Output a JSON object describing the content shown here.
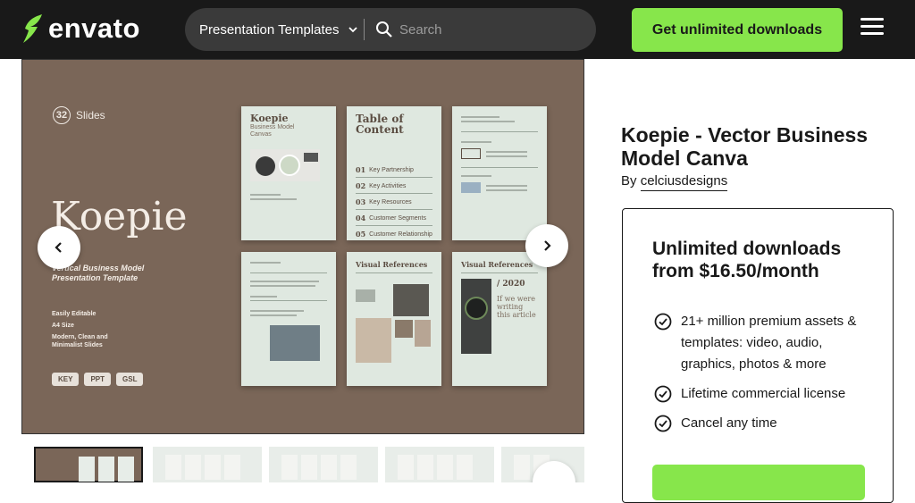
{
  "header": {
    "logo_text": "envato",
    "category": "Presentation Templates",
    "search_placeholder": "Search",
    "cta_label": "Get unlimited downloads"
  },
  "preview": {
    "slide_count": "32",
    "slides_label": "Slides",
    "title": "Koepie",
    "subtitle_line1": "Vertical Business Model",
    "subtitle_line2": "Presentation Template",
    "features": [
      "Easily Editable",
      "A4 Size",
      "Modern, Clean and",
      "Minimalist Slides"
    ],
    "formats": [
      "KEY",
      "PPT",
      "GSL"
    ],
    "page1_title": "Koepie",
    "page1_sub": "Business Model Canvas",
    "page2_title": "Table of Content",
    "toc": [
      {
        "num": "01",
        "label": "Key Partnership"
      },
      {
        "num": "02",
        "label": "Key Activities"
      },
      {
        "num": "03",
        "label": "Key Resources"
      },
      {
        "num": "04",
        "label": "Customer Segments"
      },
      {
        "num": "05",
        "label": "Customer Relationship"
      }
    ],
    "page5_title": "Visual References",
    "page6_title": "Visual References",
    "page6_year": "/ 2020",
    "page6_quote": "If we were writing this article"
  },
  "product": {
    "title": "Koepie - Vector Business Model Canva",
    "by_label": "By",
    "author": "celciusdesigns"
  },
  "offer": {
    "headline": "Unlimited downloads from $16.50/month",
    "benefits": [
      "21+ million premium assets & templates: video, audio, graphics, photos & more",
      "Lifetime commercial license",
      "Cancel any time"
    ]
  },
  "colors": {
    "brand_green": "#87e64b",
    "header_bg": "#191919",
    "preview_bg": "#7a6658",
    "page_bg": "#dfe8e0"
  }
}
